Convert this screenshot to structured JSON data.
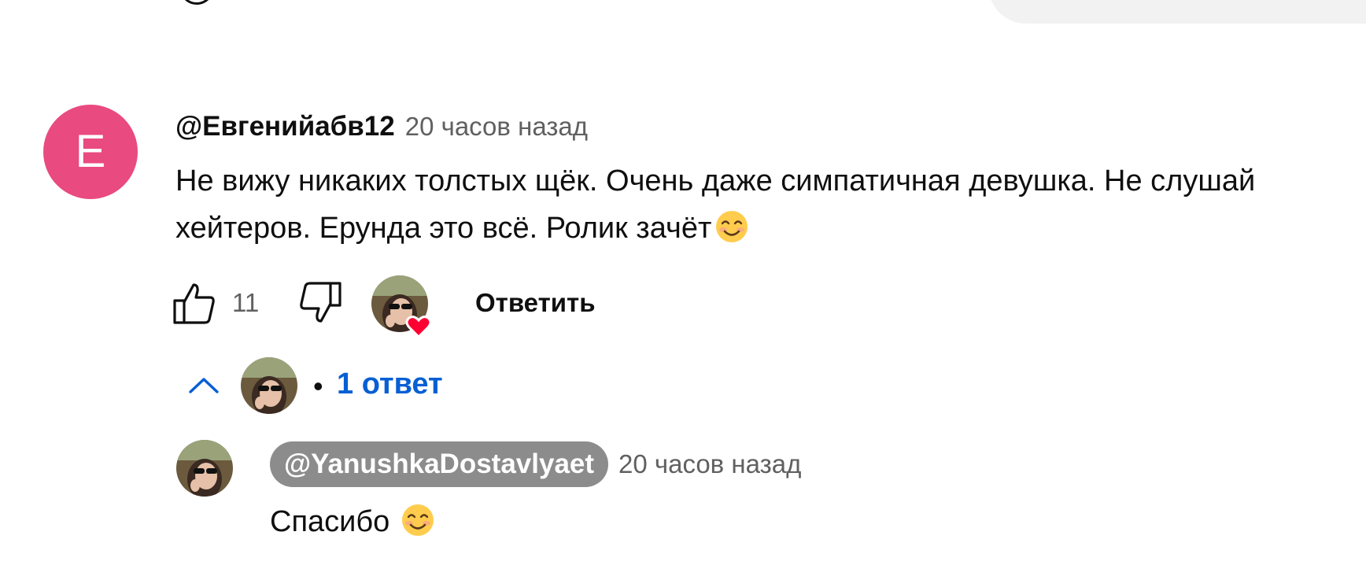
{
  "comment": {
    "avatar_letter": "E",
    "avatar_color": "#e94a7f",
    "author": "@Евгенийабв12",
    "time": "20 часов назад",
    "text": "Не вижу никаких толстых щёк. Очень даже симпатичная девушка. Не слушай хейтеров. Ерунда это всё. Ролик зачёт",
    "text_emoji": "smiling-face-icon",
    "likes": "11",
    "reply_label": "Ответить",
    "creator_heart_icon": "creator-heart-icon"
  },
  "replies_toggle": {
    "icon": "chevron-up-icon",
    "separator": "•",
    "label": "1 ответ",
    "link_color": "#065fd4"
  },
  "reply": {
    "author": "@YanushkaDostavlyaet",
    "time": "20 часов назад",
    "text": "Спасибо",
    "text_emoji": "smiling-face-icon"
  }
}
